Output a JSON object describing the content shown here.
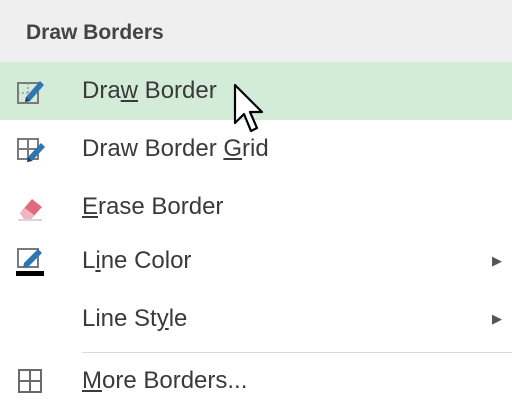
{
  "header": {
    "title": "Draw Borders"
  },
  "items": [
    {
      "name": "draw-border",
      "label": "Draw Border",
      "icon": "draw-border-icon",
      "access_key": "W",
      "submenu": false,
      "highlighted": true
    },
    {
      "name": "draw-border-grid",
      "label": "Draw Border Grid",
      "icon": "draw-border-grid-icon",
      "access_key": "G",
      "submenu": false,
      "highlighted": false
    },
    {
      "name": "erase-border",
      "label": "Erase Border",
      "icon": "eraser-icon",
      "access_key": "E",
      "submenu": false,
      "highlighted": false
    },
    {
      "name": "line-color",
      "label": "Line Color",
      "icon": "line-color-icon",
      "access_key": "I",
      "submenu": true,
      "highlighted": false
    },
    {
      "name": "line-style",
      "label": "Line Style",
      "icon": "",
      "access_key": "Y",
      "submenu": true,
      "highlighted": false
    },
    {
      "name": "more-borders",
      "label": "More Borders...",
      "icon": "grid-icon",
      "access_key": "M",
      "submenu": false,
      "highlighted": false
    }
  ],
  "colors": {
    "highlight_bg": "#d3ecd8",
    "header_bg": "#efefef",
    "pen_blue": "#2e75b6",
    "eraser_pink": "#e06b7f",
    "line_color_swatch": "#000000"
  }
}
